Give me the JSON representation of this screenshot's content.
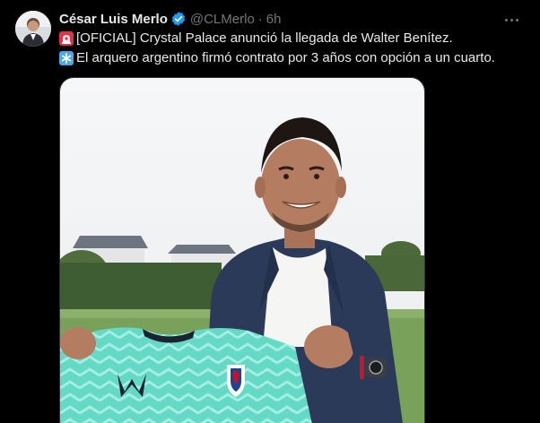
{
  "author": {
    "name": "César Luis Merlo",
    "handle": "@CLMerlo",
    "separator": "·",
    "time": "6h",
    "verified": true,
    "avatar_icon": "author-avatar"
  },
  "tweet": {
    "lines": [
      {
        "emoji": "red-siren-emoji",
        "text": "[OFICIAL] Crystal Palace anunció la llegada de Walter Benítez."
      },
      {
        "emoji": "blue-asterisk-emoji",
        "text": "El arquero argentino firmó contrato por 3 años con opción a un cuarto."
      }
    ]
  },
  "media": {
    "description_icon": "photo-player-holding-jersey"
  },
  "colors": {
    "background": "#000000",
    "text_primary": "#e7e9ea",
    "text_secondary": "#71767b",
    "verified_blue": "#1d9bf0",
    "jersey_mint": "#5fd6c3"
  }
}
